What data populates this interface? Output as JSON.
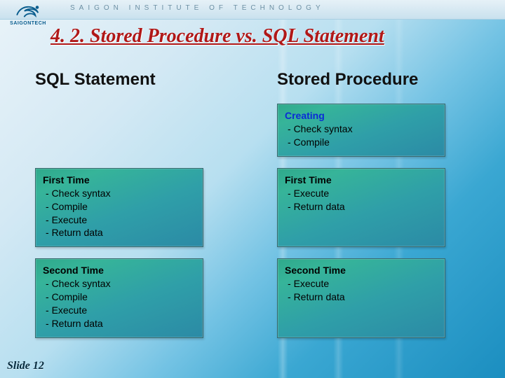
{
  "branding": {
    "logo_text": "SAIGONTECH",
    "institution": "SAIGON INSTITUTE OF TECHNOLOGY"
  },
  "title": "4. 2.  Stored Procedure vs. SQL Statement",
  "columns": {
    "left_heading": "SQL Statement",
    "right_heading": "Stored Procedure"
  },
  "cards": {
    "creating": {
      "title": "Creating",
      "items": [
        "Check syntax",
        "Compile"
      ]
    },
    "sql_first": {
      "title": "First Time",
      "items": [
        "Check syntax",
        "Compile",
        "Execute",
        "Return data"
      ]
    },
    "sp_first": {
      "title": "First Time",
      "items": [
        "Execute",
        "Return data"
      ]
    },
    "sql_second": {
      "title": "Second Time",
      "items": [
        "Check syntax",
        "Compile",
        "Execute",
        "Return data"
      ]
    },
    "sp_second": {
      "title": "Second Time",
      "items": [
        "Execute",
        "Return data"
      ]
    }
  },
  "footer": {
    "slide_label": "Slide 12"
  }
}
